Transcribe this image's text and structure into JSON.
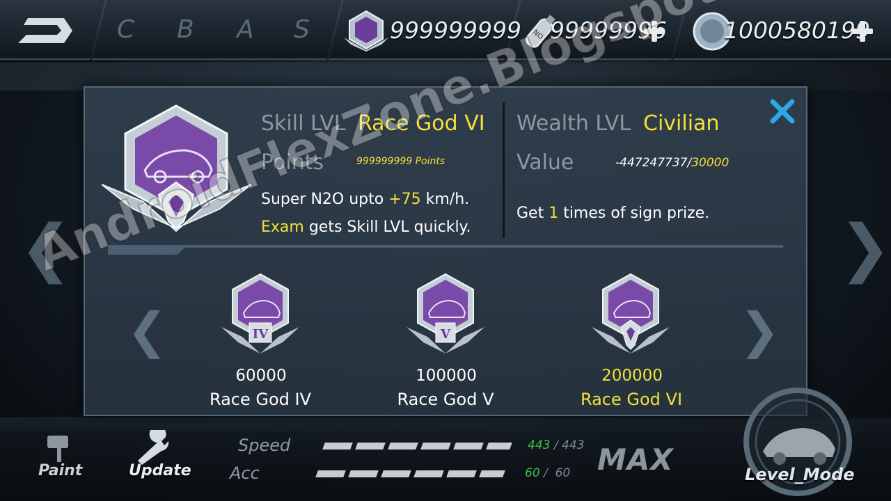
{
  "topbar": {
    "grades": [
      "C",
      "B",
      "A",
      "S"
    ],
    "currency": [
      {
        "icon": "race-god-emblem-icon",
        "value": "999999999"
      },
      {
        "icon": "nitro-bottle-icon",
        "value": "99999996"
      },
      {
        "icon": "coin-icon",
        "value": "1000580199"
      }
    ]
  },
  "dialog": {
    "skill": {
      "label": "Skill LVL",
      "value": "Race God VI",
      "points_label": "Points",
      "points_value": "999999999 Points",
      "desc1_a": "Super N2O upto ",
      "desc1_b": "+75",
      "desc1_c": " km/h.",
      "desc2_a": "Exam",
      "desc2_b": " gets Skill LVL quickly."
    },
    "wealth": {
      "label": "Wealth LVL",
      "value": "Civilian",
      "value_label": "Value",
      "value_current": "-447247737/",
      "value_target": "30000",
      "desc_a": "Get ",
      "desc_b": "1",
      "desc_c": " times of sign prize."
    },
    "tiers": [
      {
        "points": "60000",
        "name": "Race God IV",
        "numeral": "IV",
        "active": false
      },
      {
        "points": "100000",
        "name": "Race God  V",
        "numeral": "V",
        "active": false
      },
      {
        "points": "200000",
        "name": "Race God VI",
        "numeral": "",
        "active": true
      }
    ]
  },
  "bottombar": {
    "paint_label": "Paint",
    "update_label": "Update",
    "speed_label": "Speed",
    "speed_current": "443",
    "speed_max": "443",
    "acc_label": "Acc",
    "acc_current": "60",
    "acc_max": "60",
    "max_label": "MAX",
    "mode_label": "Level_Mode"
  },
  "watermark": "AndroidFlexZone.Blogspot.com",
  "colors": {
    "accent_yellow": "#f4e13a",
    "accent_blue": "#2aa8e8",
    "stat_green": "#3fbf4a"
  }
}
